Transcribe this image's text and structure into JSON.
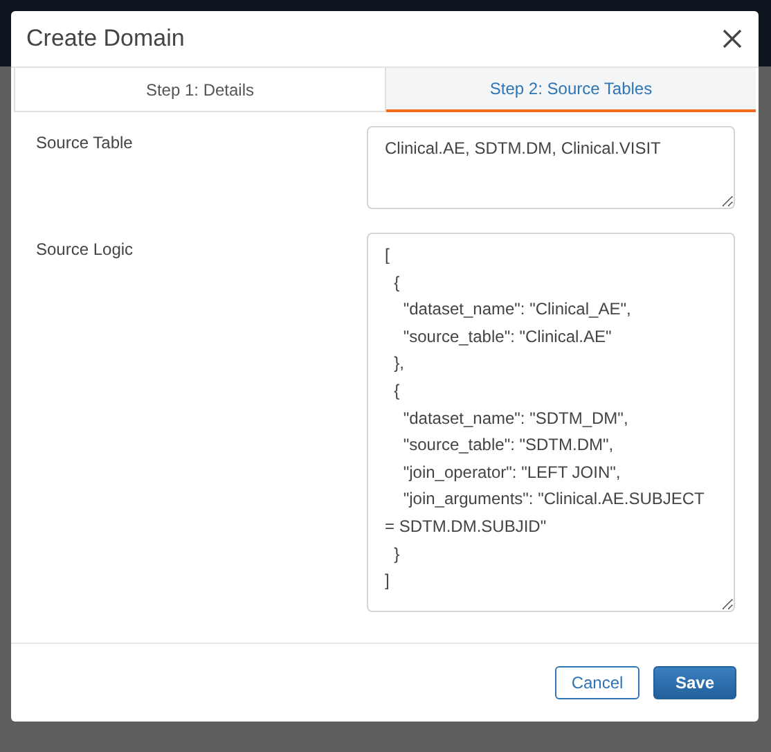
{
  "dialog": {
    "title": "Create Domain"
  },
  "tabs": [
    {
      "label": "Step 1: Details",
      "selected": false
    },
    {
      "label": "Step 2: Source Tables",
      "selected": true
    }
  ],
  "fields": [
    {
      "label": "Source Table",
      "value": "Clinical.AE, SDTM.DM, Clinical.VISIT",
      "kind": "short"
    },
    {
      "label": "Source Logic",
      "value": "[\n  {\n    \"dataset_name\": \"Clinical_AE\",\n    \"source_table\": \"Clinical.AE\"\n  },\n  {\n    \"dataset_name\": \"SDTM_DM\",\n    \"source_table\": \"SDTM.DM\",\n    \"join_operator\": \"LEFT JOIN\",\n    \"join_arguments\": \"Clinical.AE.SUBJECT = SDTM.DM.SUBJID\"\n  }\n]",
      "kind": "long"
    }
  ],
  "buttons": [
    {
      "label": "Cancel",
      "kind": "secondary"
    },
    {
      "label": "Save",
      "kind": "primary"
    }
  ]
}
